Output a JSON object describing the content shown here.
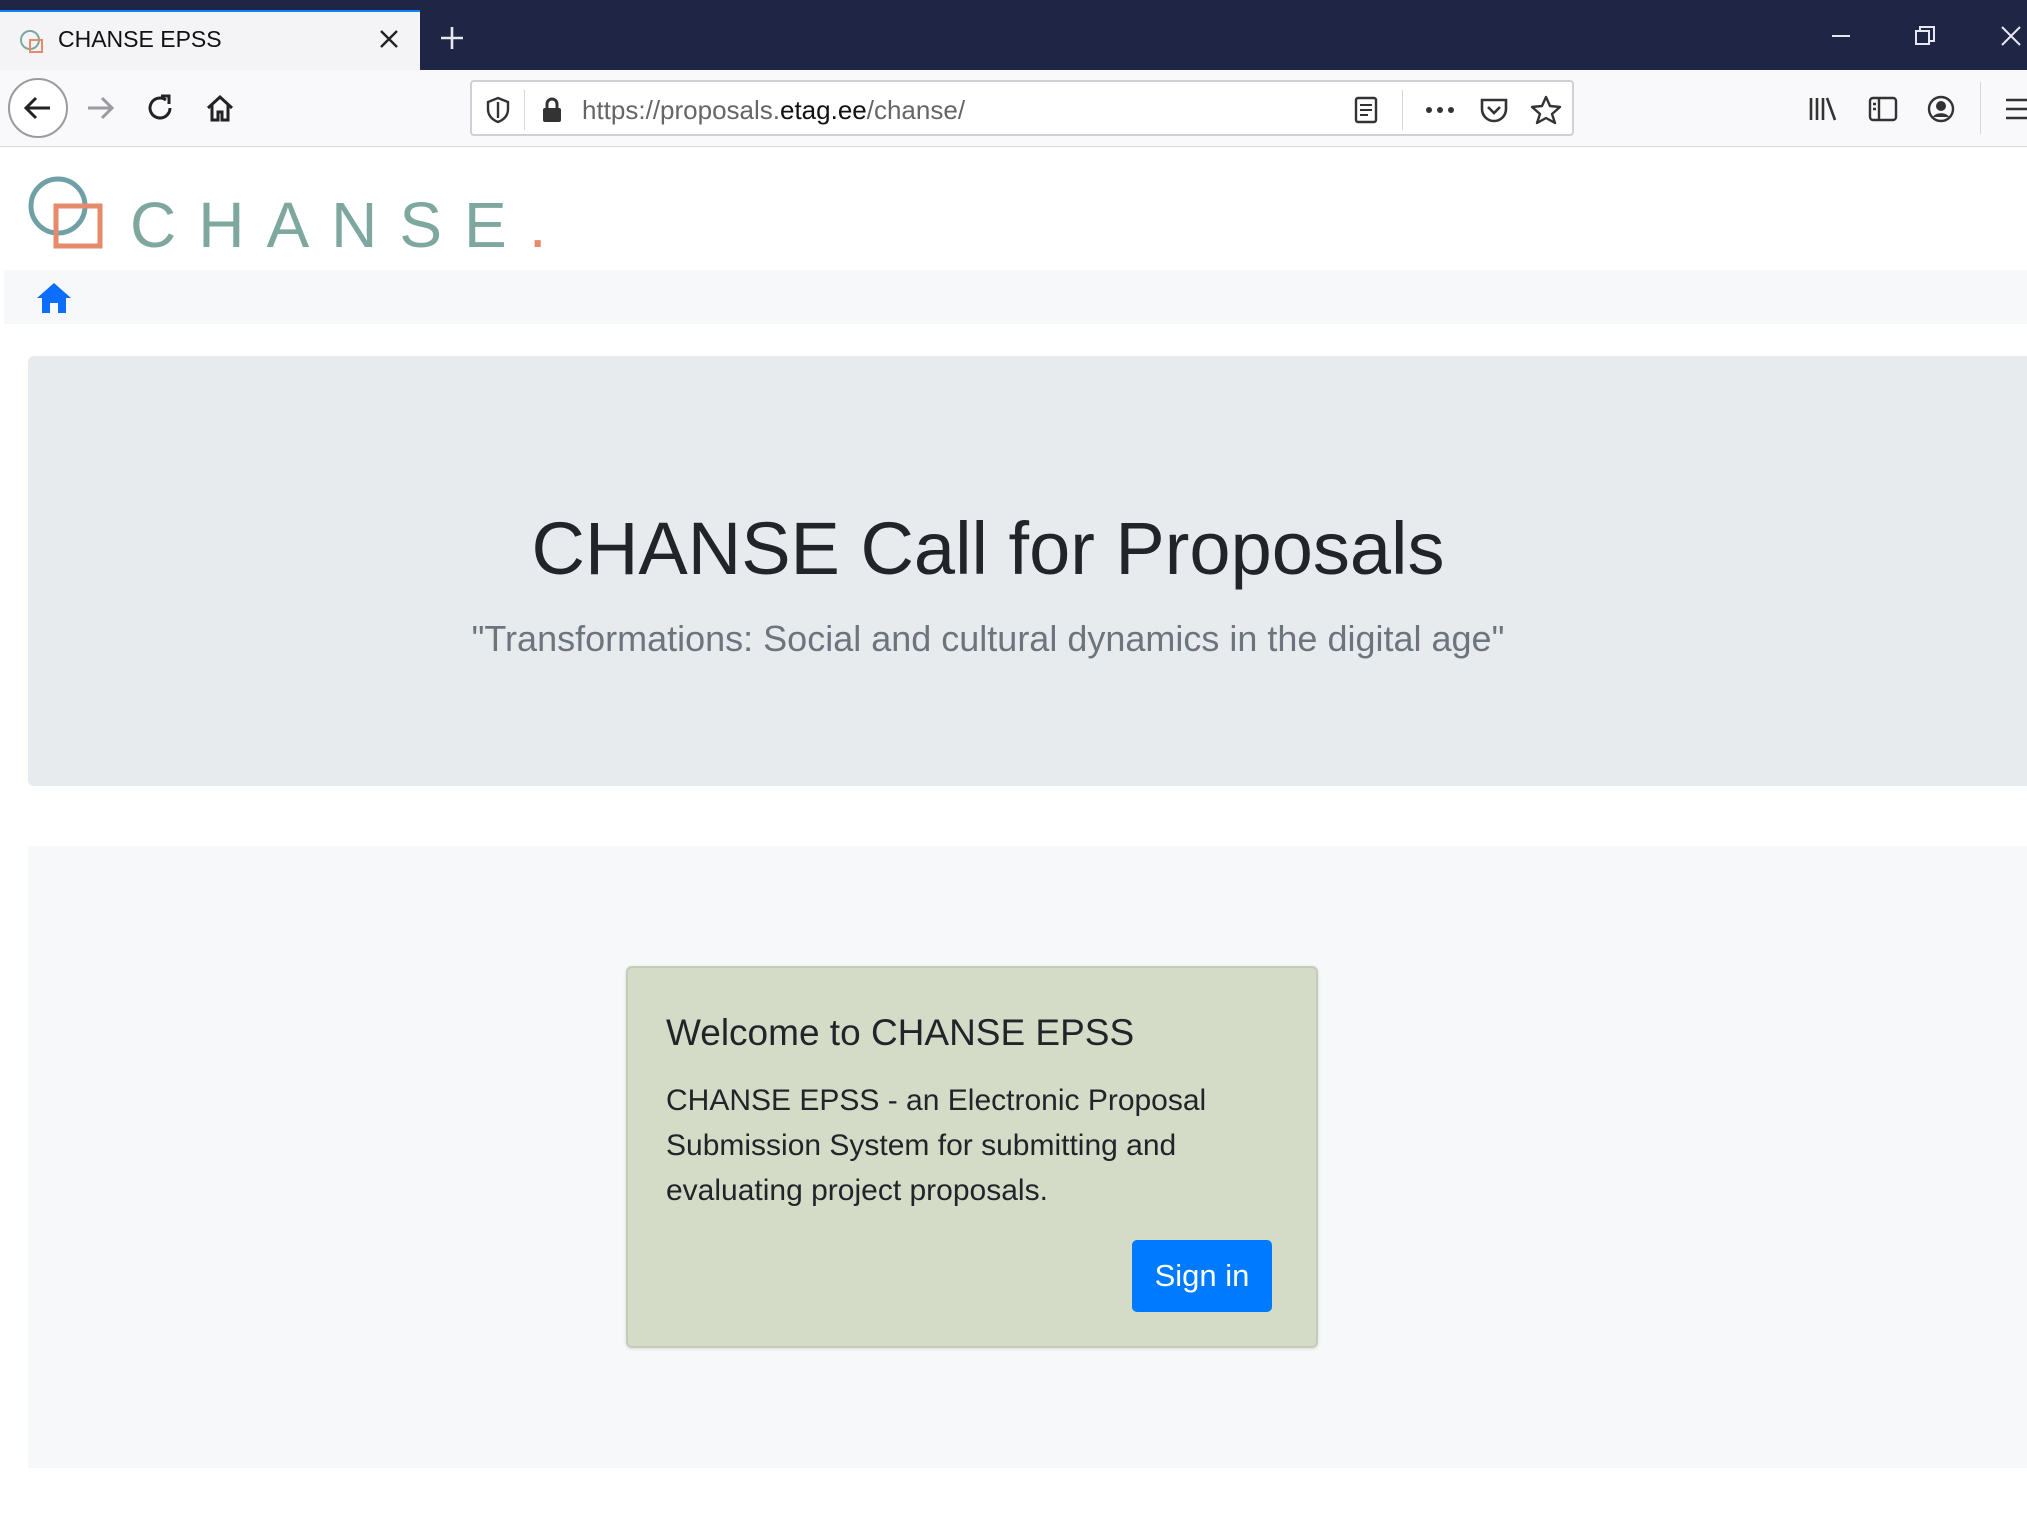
{
  "browser": {
    "tab_title": "CHANSE EPSS",
    "url_prefix": "https://proposals.",
    "url_domain": "etag.ee",
    "url_path": "/chanse/"
  },
  "site": {
    "logo_text": "CHANSE",
    "logo_dot": "."
  },
  "jumbotron": {
    "title": "CHANSE Call for Proposals",
    "subtitle": "\"Transformations: Social and cultural dynamics in the digital age\""
  },
  "welcome_card": {
    "title": "Welcome to CHANSE EPSS",
    "text": "CHANSE EPSS - an Electronic Proposal Submission System for submitting and evaluating project proposals.",
    "button_label": "Sign in"
  },
  "colors": {
    "tab_strip": "#1f2544",
    "logo_teal": "#7ea79f",
    "logo_orange": "#e58a6a",
    "primary_button": "#007bff",
    "card_bg": "#d4dcc8",
    "jumbotron_bg": "#e8ebee"
  },
  "icons": [
    "tab-favicon",
    "close-icon",
    "plus-icon",
    "minimize-icon",
    "restore-icon",
    "close-window-icon",
    "back-icon",
    "forward-icon",
    "reload-icon",
    "home-icon",
    "shield-icon",
    "lock-icon",
    "reader-view-icon",
    "more-icon",
    "pocket-icon",
    "star-icon",
    "library-icon",
    "sidebar-icon",
    "account-icon",
    "menu-icon"
  ]
}
